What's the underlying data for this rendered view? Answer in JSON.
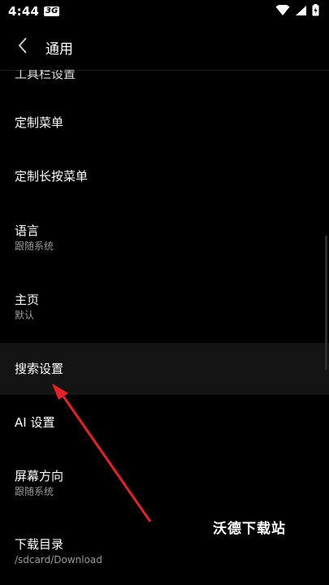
{
  "status_bar": {
    "time": "4:44",
    "sim_badge": "3G",
    "icons": [
      "wifi-icon",
      "signal-icon",
      "battery-charging-icon"
    ]
  },
  "app_bar": {
    "back_icon": "chevron-left-icon",
    "title": "通用"
  },
  "list": {
    "partial_top_label": "工具栏设置",
    "items": [
      {
        "label": "定制菜单",
        "sub": ""
      },
      {
        "label": "定制长按菜单",
        "sub": ""
      },
      {
        "label": "语言",
        "sub": "跟随系统"
      },
      {
        "label": "主页",
        "sub": "默认"
      },
      {
        "label": "搜索设置",
        "sub": ""
      },
      {
        "label": "AI 设置",
        "sub": ""
      },
      {
        "label": "屏幕方向",
        "sub": "跟随系统"
      },
      {
        "label": "下载目录",
        "sub": "/sdcard/Download"
      }
    ]
  },
  "watermark": "沃德下载站",
  "colors": {
    "background": "#000000",
    "highlight_row": "#141414",
    "arrow": "#e8202a",
    "subtext": "#9a9a9a"
  }
}
